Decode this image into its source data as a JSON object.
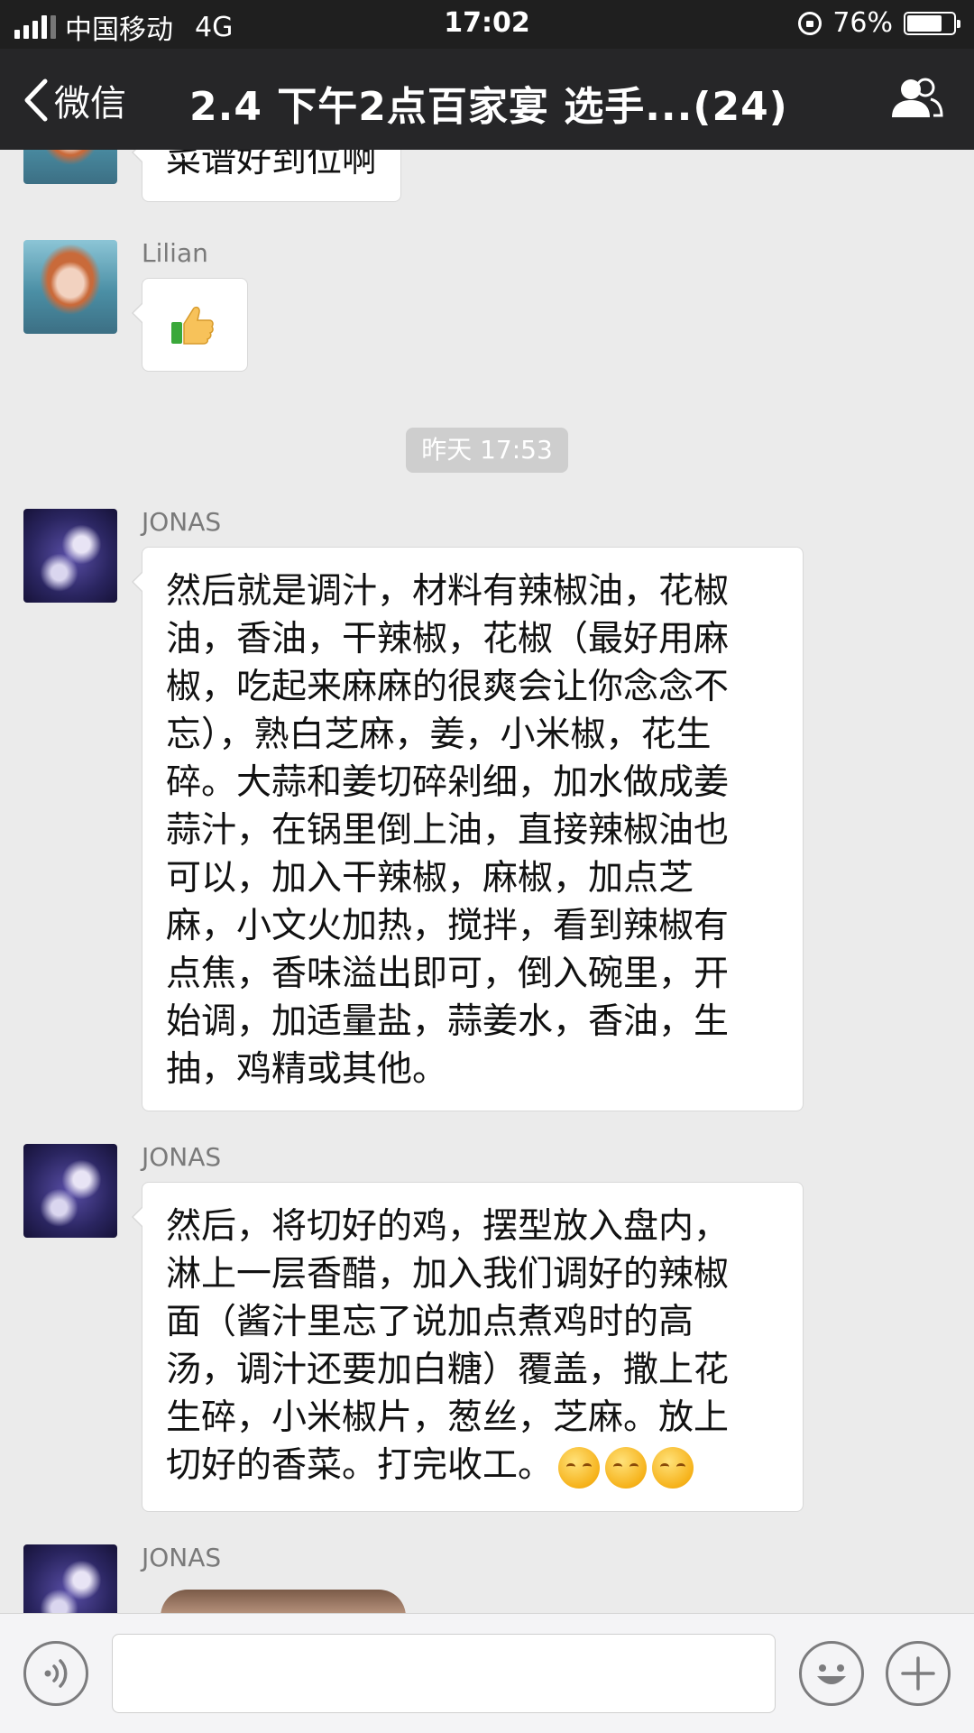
{
  "status_bar": {
    "carrier": "中国移动",
    "network": "4G",
    "time": "17:02",
    "battery_percent": "76%",
    "battery_level": 0.76,
    "signal_bars": 4
  },
  "nav": {
    "back_label": "微信",
    "title": "2.4 下午2点百家宴 选手...(24)"
  },
  "chat": {
    "messages": [
      {
        "sender": "",
        "text": "菜谱好到位啊"
      },
      {
        "sender": "Lilian",
        "content": "thumbs-up-emoji"
      },
      {
        "timestamp": "昨天 17:53"
      },
      {
        "sender": "JONAS",
        "lines": [
          "然后就是调汁，材料有辣椒油，花椒",
          "油，香油，干辣椒，花椒（最好用麻",
          "椒，吃起来麻麻的很爽会让你念念不",
          "忘），熟白芝麻，姜，小米椒，花生",
          "碎。大蒜和姜切碎剁细，加水做成姜",
          "蒜汁，在锅里倒上油，直接辣椒油也",
          "可以，加入干辣椒，麻椒，加点芝",
          "麻，小文火加热，搅拌，看到辣椒有",
          "点焦，香味溢出即可，倒入碗里，开",
          "始调，加适量盐，蒜姜水，香油，生",
          "抽，鸡精或其他。"
        ]
      },
      {
        "sender": "JONAS",
        "lines": [
          "然后，将切好的鸡，摆型放入盘内，",
          "淋上一层香醋，加入我们调好的辣椒",
          "面（酱汁里忘了说加点煮鸡时的高",
          "汤，调汁还要加白糖）覆盖，撒上花",
          "生碎，小米椒片，葱丝，芝麻。放上",
          "切好的香菜。打完收工。"
        ],
        "trailing_emoji": [
          "blush-emoji",
          "blush-emoji",
          "blush-emoji"
        ]
      },
      {
        "sender": "JONAS",
        "content": "image-message"
      }
    ]
  },
  "input_bar": {
    "text_value": "",
    "icons": [
      "voice-icon",
      "emoji-icon",
      "plus-icon"
    ]
  },
  "colors": {
    "status_bg": "#1f1f1f",
    "nav_bg": "#262628",
    "chat_bg": "#ebebeb",
    "bubble_bg": "#ffffff",
    "input_bg": "#f4f4f6"
  }
}
